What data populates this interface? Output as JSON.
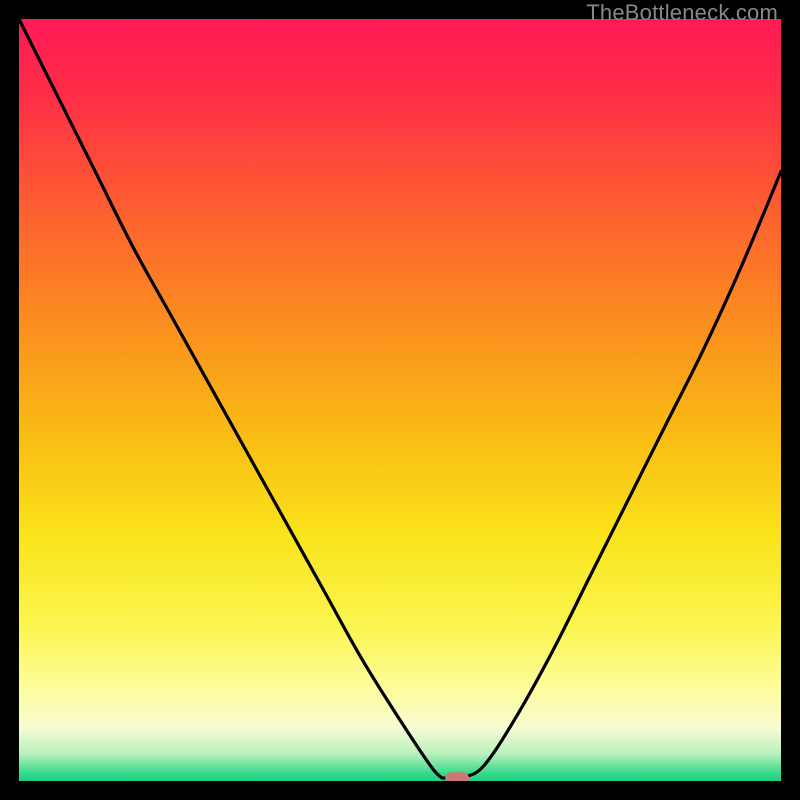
{
  "watermark": "TheBottleneck.com",
  "colors": {
    "bg": "#000000",
    "curve": "#000000",
    "marker_fill": "#c97a74",
    "marker_stroke": "#c97a74",
    "gradient_stops": [
      {
        "offset": 0.0,
        "color": "#ff1a55"
      },
      {
        "offset": 0.1,
        "color": "#ff2e47"
      },
      {
        "offset": 0.25,
        "color": "#fd5f30"
      },
      {
        "offset": 0.4,
        "color": "#fb8e1f"
      },
      {
        "offset": 0.55,
        "color": "#f9bd14"
      },
      {
        "offset": 0.68,
        "color": "#fae41a"
      },
      {
        "offset": 0.8,
        "color": "#fbf653"
      },
      {
        "offset": 0.88,
        "color": "#fdfc9e"
      },
      {
        "offset": 0.93,
        "color": "#f7fbd2"
      },
      {
        "offset": 0.965,
        "color": "#b8f0bd"
      },
      {
        "offset": 0.99,
        "color": "#36d98a"
      },
      {
        "offset": 1.0,
        "color": "#1fcf82"
      }
    ]
  },
  "chart_data": {
    "type": "line",
    "title": "",
    "xlabel": "",
    "ylabel": "",
    "xlim": [
      0,
      100
    ],
    "ylim": [
      0,
      100
    ],
    "series": [
      {
        "name": "bottleneck-curve",
        "x": [
          0,
          5,
          10,
          15,
          20,
          25,
          30,
          35,
          40,
          45,
          50,
          54,
          55.5,
          57,
          58.5,
          61,
          65,
          70,
          75,
          80,
          85,
          90,
          95,
          100
        ],
        "y": [
          100,
          90,
          80,
          70,
          61,
          52,
          43,
          34,
          25,
          16,
          8,
          2,
          0.4,
          0.3,
          0.5,
          2,
          8,
          17,
          27,
          37,
          47,
          57,
          68,
          80
        ]
      }
    ],
    "marker": {
      "x": 57.5,
      "y": 0.3
    },
    "annotations": []
  }
}
